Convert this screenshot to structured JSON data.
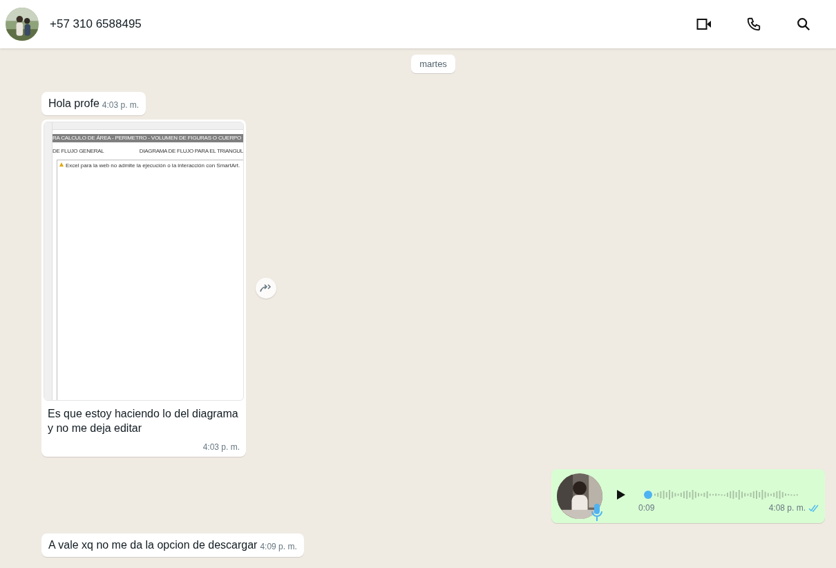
{
  "header": {
    "contact": "+57 310 6588495"
  },
  "date_chip": "martes",
  "messages": [
    {
      "kind": "text",
      "outgoing": false,
      "text": "Hola profe",
      "time": "4:03 p. m."
    },
    {
      "outgoing": false,
      "sheet": {
        "title": "RA CALCULO DE ÁREA - PERIMETRO - VOLUMEN DE FIGURAS O CUERPO",
        "left_heading": "DE FLUJO GENERAL",
        "right_heading": "DIAGRAMA DE FLUJO PARA EL TRIANGUL",
        "warning": "Excel para la web no admite la ejecución o la interacción con SmartArt."
      },
      "caption": "Es que estoy haciendo lo del diagrama y no me deja editar",
      "time": "4:03 p. m."
    },
    {
      "kind": "voice",
      "outgoing": true,
      "duration": "0:09",
      "time": "4:08 p. m.",
      "read": true
    },
    {
      "kind": "text",
      "outgoing": false,
      "text": "A vale xq no me da la opcion de descargar",
      "time": "4:09 p. m."
    }
  ]
}
